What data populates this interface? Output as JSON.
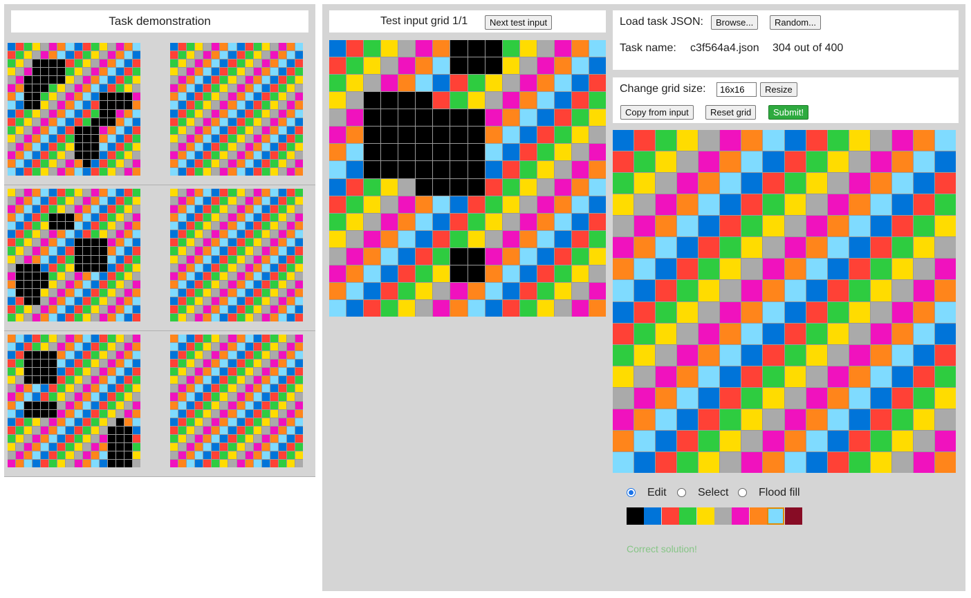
{
  "palette": [
    "#000000",
    "#0074D9",
    "#FF4136",
    "#2ECC40",
    "#FFDC00",
    "#AAAAAA",
    "#F012BE",
    "#FF851B",
    "#7FDBFF",
    "#870C25"
  ],
  "demo": {
    "title": "Task demonstration",
    "pairs": [
      {
        "input_black": [
          [
            4,
            2
          ],
          [
            4,
            3
          ],
          [
            5,
            2
          ],
          [
            5,
            3
          ],
          [
            6,
            2
          ],
          [
            6,
            3
          ],
          [
            7,
            2
          ],
          [
            7,
            3
          ],
          [
            2,
            3
          ],
          [
            2,
            4
          ],
          [
            3,
            3
          ],
          [
            3,
            4
          ],
          [
            4,
            4
          ],
          [
            5,
            4
          ],
          [
            2,
            5
          ],
          [
            3,
            5
          ],
          [
            4,
            5
          ],
          [
            4,
            6
          ],
          [
            3,
            6
          ],
          [
            2,
            6
          ],
          [
            6,
            11
          ],
          [
            6,
            12
          ],
          [
            6,
            13
          ],
          [
            6,
            14
          ],
          [
            7,
            11
          ],
          [
            7,
            12
          ],
          [
            7,
            13
          ],
          [
            7,
            14
          ],
          [
            10,
            8
          ],
          [
            10,
            9
          ],
          [
            10,
            10
          ],
          [
            11,
            8
          ],
          [
            11,
            9
          ],
          [
            11,
            10
          ],
          [
            12,
            8
          ],
          [
            12,
            9
          ],
          [
            12,
            10
          ],
          [
            13,
            8
          ],
          [
            13,
            9
          ],
          [
            13,
            10
          ],
          [
            14,
            9
          ],
          [
            9,
            10
          ],
          [
            9,
            11
          ],
          [
            8,
            11
          ],
          [
            8,
            12
          ],
          [
            9,
            12
          ]
        ]
      },
      {
        "input_black": [
          [
            3,
            5
          ],
          [
            3,
            6
          ],
          [
            3,
            7
          ],
          [
            4,
            5
          ],
          [
            4,
            6
          ],
          [
            4,
            7
          ],
          [
            6,
            8
          ],
          [
            6,
            9
          ],
          [
            6,
            10
          ],
          [
            6,
            11
          ],
          [
            7,
            8
          ],
          [
            7,
            9
          ],
          [
            7,
            10
          ],
          [
            7,
            11
          ],
          [
            8,
            8
          ],
          [
            8,
            9
          ],
          [
            8,
            10
          ],
          [
            8,
            11
          ],
          [
            9,
            8
          ],
          [
            9,
            9
          ],
          [
            9,
            10
          ],
          [
            9,
            11
          ],
          [
            9,
            1
          ],
          [
            9,
            2
          ],
          [
            9,
            3
          ],
          [
            10,
            1
          ],
          [
            10,
            2
          ],
          [
            10,
            3
          ],
          [
            11,
            1
          ],
          [
            11,
            2
          ],
          [
            11,
            3
          ],
          [
            12,
            1
          ],
          [
            12,
            2
          ],
          [
            12,
            3
          ],
          [
            13,
            2
          ],
          [
            13,
            3
          ],
          [
            10,
            4
          ],
          [
            11,
            4
          ]
        ]
      },
      {
        "input_black": [
          [
            2,
            2
          ],
          [
            2,
            3
          ],
          [
            2,
            4
          ],
          [
            2,
            5
          ],
          [
            3,
            2
          ],
          [
            3,
            3
          ],
          [
            3,
            4
          ],
          [
            3,
            5
          ],
          [
            4,
            2
          ],
          [
            4,
            3
          ],
          [
            4,
            4
          ],
          [
            4,
            5
          ],
          [
            5,
            2
          ],
          [
            5,
            3
          ],
          [
            5,
            4
          ],
          [
            5,
            5
          ],
          [
            8,
            2
          ],
          [
            8,
            3
          ],
          [
            8,
            4
          ],
          [
            8,
            5
          ],
          [
            9,
            2
          ],
          [
            9,
            3
          ],
          [
            9,
            4
          ],
          [
            9,
            5
          ],
          [
            11,
            12
          ],
          [
            11,
            13
          ],
          [
            12,
            12
          ],
          [
            12,
            13
          ],
          [
            12,
            14
          ],
          [
            13,
            12
          ],
          [
            13,
            13
          ],
          [
            13,
            14
          ],
          [
            14,
            12
          ],
          [
            14,
            13
          ],
          [
            14,
            14
          ],
          [
            15,
            12
          ],
          [
            15,
            13
          ],
          [
            15,
            14
          ],
          [
            10,
            13
          ],
          [
            11,
            14
          ]
        ]
      }
    ]
  },
  "test": {
    "title": "Test input grid 1/1",
    "next_label": "Next test input",
    "black": [
      [
        0,
        7
      ],
      [
        0,
        8
      ],
      [
        0,
        9
      ],
      [
        1,
        7
      ],
      [
        1,
        8
      ],
      [
        1,
        9
      ],
      [
        3,
        2
      ],
      [
        3,
        3
      ],
      [
        3,
        4
      ],
      [
        3,
        5
      ],
      [
        4,
        2
      ],
      [
        4,
        3
      ],
      [
        4,
        4
      ],
      [
        4,
        5
      ],
      [
        4,
        6
      ],
      [
        4,
        7
      ],
      [
        4,
        8
      ],
      [
        5,
        2
      ],
      [
        5,
        3
      ],
      [
        5,
        4
      ],
      [
        5,
        5
      ],
      [
        5,
        6
      ],
      [
        5,
        7
      ],
      [
        5,
        8
      ],
      [
        6,
        2
      ],
      [
        6,
        3
      ],
      [
        6,
        4
      ],
      [
        6,
        5
      ],
      [
        6,
        6
      ],
      [
        6,
        7
      ],
      [
        6,
        8
      ],
      [
        7,
        2
      ],
      [
        7,
        3
      ],
      [
        7,
        4
      ],
      [
        7,
        5
      ],
      [
        7,
        6
      ],
      [
        7,
        7
      ],
      [
        7,
        8
      ],
      [
        8,
        5
      ],
      [
        8,
        6
      ],
      [
        8,
        7
      ],
      [
        8,
        8
      ],
      [
        12,
        7
      ],
      [
        12,
        8
      ],
      [
        13,
        7
      ],
      [
        13,
        8
      ]
    ]
  },
  "controls": {
    "load_label": "Load task JSON:",
    "browse_label": "Browse...",
    "random_label": "Random...",
    "task_name_label": "Task name:",
    "task_name_value": "c3f564a4.json",
    "task_progress": "304 out of 400",
    "grid_size_label": "Change grid size:",
    "grid_size_value": "16x16",
    "resize_label": "Resize",
    "copy_label": "Copy from input",
    "reset_label": "Reset grid",
    "submit_label": "Submit!"
  },
  "tools": {
    "modes": [
      "Edit",
      "Select",
      "Flood fill"
    ],
    "selected_mode": "Edit",
    "selected_color_index": 8
  },
  "status": "Correct solution!"
}
